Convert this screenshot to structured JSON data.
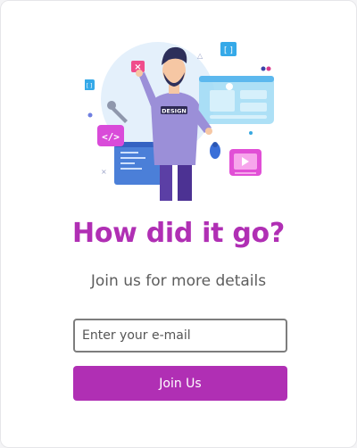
{
  "heading": "How did it go?",
  "subheading": "Join us for more details",
  "form": {
    "email_placeholder": "Enter your e-mail",
    "email_value": "",
    "join_label": "Join Us"
  },
  "illustration": {
    "shirt_text": "DESIGN",
    "code_symbol": "</>",
    "bracket_symbol": "[ ]"
  },
  "colors": {
    "accent": "#b02fb4",
    "text_muted": "#5d5d5d",
    "input_border": "#7d7d7d"
  }
}
